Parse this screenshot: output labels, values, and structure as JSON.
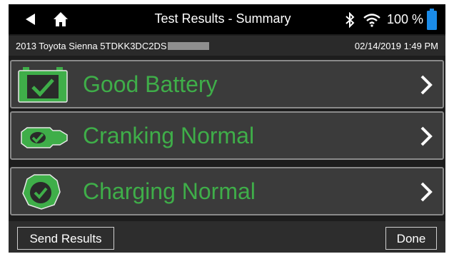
{
  "status_bar": {
    "title": "Test Results - Summary",
    "battery_percent": "100 %",
    "icons": [
      "back-icon",
      "home-icon",
      "bluetooth-icon",
      "wifi-icon",
      "battery-icon"
    ]
  },
  "vehicle_info": {
    "vehicle": "2013 Toyota Sienna  5TDKK3DC2DS",
    "datetime": "02/14/2019 1:49 PM"
  },
  "results": [
    {
      "label": "Good Battery",
      "icon": "battery-check-icon"
    },
    {
      "label": "Cranking Normal",
      "icon": "starter-motor-check-icon"
    },
    {
      "label": "Charging Normal",
      "icon": "alternator-check-icon"
    }
  ],
  "footer": {
    "send_label": "Send Results",
    "done_label": "Done"
  },
  "colors": {
    "accent_green": "#3fae49",
    "battery_blue": "#1a8be8",
    "row_background": "#3b3b3b",
    "row_border": "#8a8a8a"
  }
}
